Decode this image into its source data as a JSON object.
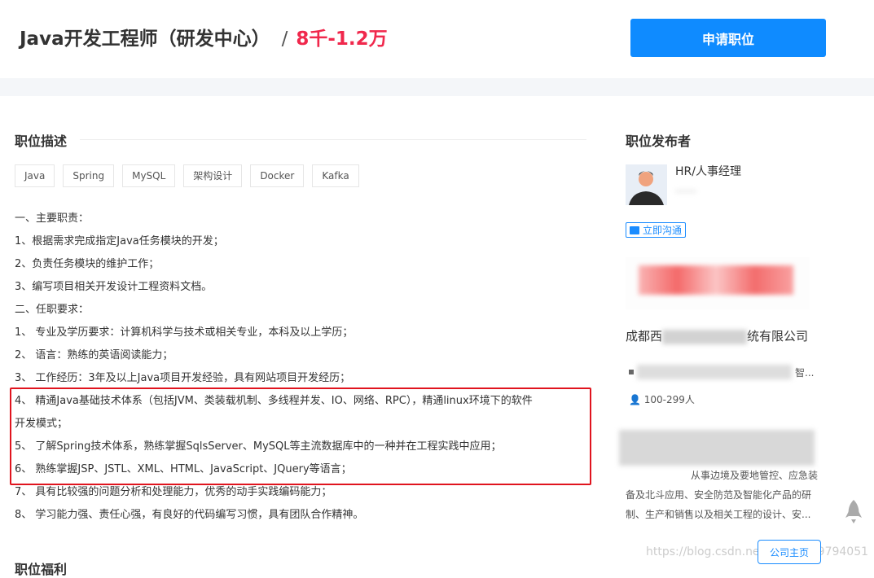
{
  "header": {
    "title": "Java开发工程师（研发中心）",
    "separator": "/",
    "salary": "8千-1.2万",
    "apply_label": "申请职位"
  },
  "description": {
    "section_title": "职位描述",
    "tags": [
      "Java",
      "Spring",
      "MySQL",
      "架构设计",
      "Docker",
      "Kafka"
    ],
    "lines": [
      "一、主要职责：",
      "1、根据需求完成指定Java任务模块的开发；",
      "2、负责任务模块的维护工作；",
      "3、编写项目相关开发设计工程资料文档。",
      "二、任职要求：",
      "1、 专业及学历要求：计算机科学与技术或相关专业，本科及以上学历；",
      "2、 语言：熟练的英语阅读能力；",
      "3、 工作经历：3年及以上Java项目开发经验，具有网站项目开发经历；",
      "4、 精通Java基础技术体系（包括JVM、类装载机制、多线程并发、IO、网络、RPC），精通linux环境下的软件",
      "开发模式；",
      "5、 了解Spring技术体系，熟练掌握SqlsServer、MySQL等主流数据库中的一种并在工程实践中应用；",
      "6、 熟练掌握JSP、JSTL、XML、HTML、JavaScript、JQuery等语言；",
      "7、 具有比较强的问题分析和处理能力，优秀的动手实践编码能力；",
      "8、 学习能力强、责任心强，有良好的代码编写习惯，具有团队合作精神。"
    ],
    "benefits_title": "职位福利"
  },
  "publisher": {
    "section_title": "职位发布者",
    "role": "HR/人事经理",
    "chat_label": "立即沟通",
    "company_prefix": "成都西",
    "company_suffix": "统有限公司",
    "industry_suffix": "智...",
    "size": "100-299人",
    "intro_lines": [
      "从事边境及要地管控、应急装",
      "备及北斗应用、安全防范及智能化产品的研",
      "制、生产和销售以及相关工程的设计、安..."
    ],
    "home_label": "公司主页"
  },
  "watermark": "https://blog.csdn.net/weixin_49794051",
  "colors": {
    "accent": "#0f8bff",
    "salary": "#f0284c",
    "highlight_box": "#e0141e"
  }
}
